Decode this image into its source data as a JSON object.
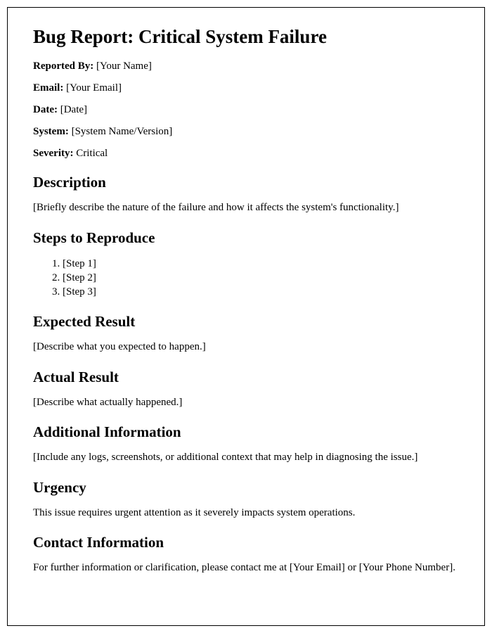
{
  "title": "Bug Report: Critical System Failure",
  "meta": {
    "reported_by_label": "Reported By:",
    "reported_by_value": "[Your Name]",
    "email_label": "Email:",
    "email_value": "[Your Email]",
    "date_label": "Date:",
    "date_value": "[Date]",
    "system_label": "System:",
    "system_value": "[System Name/Version]",
    "severity_label": "Severity:",
    "severity_value": "Critical"
  },
  "sections": {
    "description": {
      "heading": "Description",
      "body": "[Briefly describe the nature of the failure and how it affects the system's functionality.]"
    },
    "steps": {
      "heading": "Steps to Reproduce",
      "items": [
        "[Step 1]",
        "[Step 2]",
        "[Step 3]"
      ]
    },
    "expected": {
      "heading": "Expected Result",
      "body": "[Describe what you expected to happen.]"
    },
    "actual": {
      "heading": "Actual Result",
      "body": "[Describe what actually happened.]"
    },
    "additional": {
      "heading": "Additional Information",
      "body": "[Include any logs, screenshots, or additional context that may help in diagnosing the issue.]"
    },
    "urgency": {
      "heading": "Urgency",
      "body": "This issue requires urgent attention as it severely impacts system operations."
    },
    "contact": {
      "heading": "Contact Information",
      "body": "For further information or clarification, please contact me at [Your Email] or [Your Phone Number]."
    }
  }
}
